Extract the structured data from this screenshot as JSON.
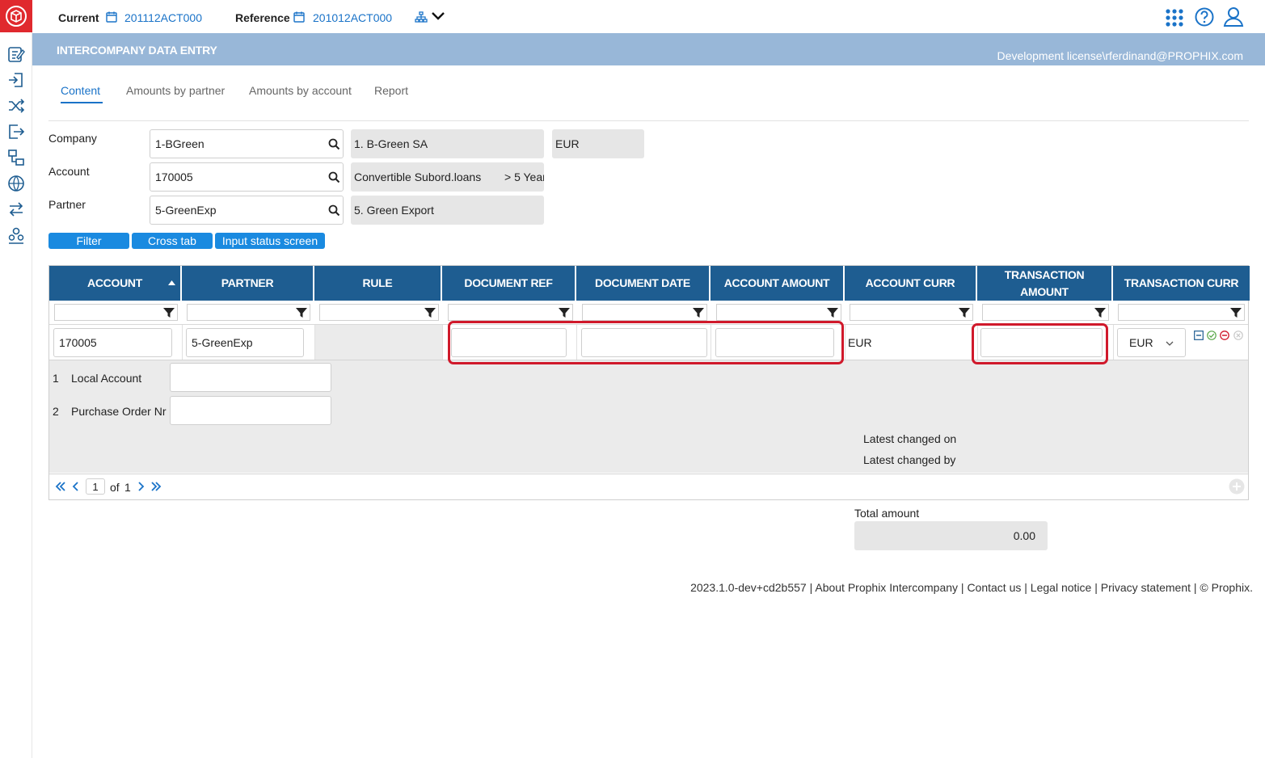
{
  "topbar": {
    "current_label": "Current",
    "current_value": "201112ACT000",
    "reference_label": "Reference",
    "reference_value": "201012ACT000"
  },
  "header": {
    "title": "INTERCOMPANY DATA ENTRY",
    "license": "Development license\\rferdinand@PROPHIX.com"
  },
  "tabs": [
    {
      "label": "Content",
      "active": true
    },
    {
      "label": "Amounts by partner"
    },
    {
      "label": "Amounts by account"
    },
    {
      "label": "Report"
    }
  ],
  "filters": {
    "company": {
      "label": "Company",
      "value": "1-BGreen",
      "description": "1. B-Green SA",
      "currency": "EUR"
    },
    "account": {
      "label": "Account",
      "value": "170005",
      "description": "Convertible Subord.loans",
      "term": "> 5 Year"
    },
    "partner": {
      "label": "Partner",
      "value": "5-GreenExp",
      "description": "5. Green Export"
    }
  },
  "buttons": {
    "filter": "Filter",
    "cross_tab": "Cross tab",
    "input_status": "Input status screen"
  },
  "grid": {
    "columns": [
      "ACCOUNT",
      "PARTNER",
      "RULE",
      "DOCUMENT REF",
      "DOCUMENT DATE",
      "ACCOUNT AMOUNT",
      "ACCOUNT CURR",
      "TRANSACTION AMOUNT",
      "TRANSACTION CURR"
    ],
    "row": {
      "account": "170005",
      "partner": "5-GreenExp",
      "rule": "",
      "document_ref": "",
      "document_date": "",
      "account_amount": "",
      "account_curr": "EUR",
      "transaction_amount": "",
      "transaction_curr": "EUR"
    },
    "detail": {
      "fields": [
        {
          "index": "1",
          "label": "Local Account",
          "value": ""
        },
        {
          "index": "2",
          "label": "Purchase Order Nr",
          "value": ""
        }
      ],
      "latest_changed_on": "Latest changed on",
      "latest_changed_by": "Latest changed by"
    },
    "pager": {
      "page": "1",
      "of_label": "of",
      "total_pages": "1"
    }
  },
  "total": {
    "label": "Total amount",
    "value": "0.00"
  },
  "footer": {
    "version": "2023.1.0-dev+cd2b557",
    "about": "About Prophix Intercompany",
    "contact": "Contact us",
    "legal": "Legal notice",
    "privacy": "Privacy statement",
    "copyright": "© Prophix."
  },
  "colors": {
    "brand_red": "#e0292e",
    "header_blue": "#98b7d8",
    "grid_header": "#1e5d91",
    "accent": "#1a8ae0",
    "highlight_red": "#d0192b"
  }
}
